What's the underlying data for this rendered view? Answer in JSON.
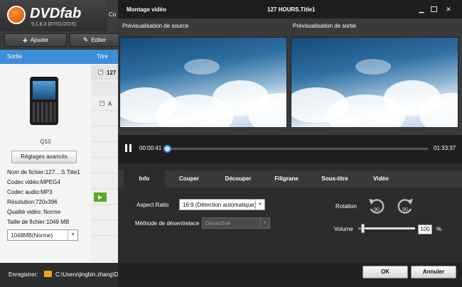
{
  "app": {
    "logo_text": "DVDfab",
    "version": "9.1.8.3 (07/01/2015)",
    "add_label": "Ajouter",
    "edit_label": "Editer",
    "topright_tab": "Co",
    "output_header": "Sortie",
    "title_header": "Titre",
    "title_row_1": "127",
    "title_row_2": "A",
    "device_name": "Q10",
    "advanced_settings": "Réglages avancés",
    "file_info": [
      "Nom de fichier:127....S.Title1",
      "Codec vidéo:MPEG4",
      "Codec audio:MP3",
      "Résolution:720x396",
      "Qualité vidéo: Norme",
      "Taille de fichier:1049 MB"
    ],
    "size_select": "1048MB(Norme)",
    "save_label": "Enregistrer:",
    "save_path": "C:\\Users\\jingbin.zhang\\D"
  },
  "dialog": {
    "title": "Montage vidéo",
    "file_title": "127  HOURS.Title1",
    "source_label": "Prévisualisation de source",
    "output_label": "Prévisualisation de sortie",
    "current_time": "00:00:41",
    "total_time": "01:33:37",
    "progress": 0.0073,
    "tabs": [
      "Info",
      "Couper",
      "Découper",
      "Filigrane",
      "Sous-titre",
      "Vidéo"
    ],
    "active_tab": "Info",
    "aspect_label": "Aspect Ratio",
    "aspect_value": "16:9 (Détection automatique)",
    "deinterlace_label": "Méthode de désentrelace",
    "deinterlace_value": "Désactivé",
    "rotation_label": "Rotation",
    "rotate_left_value": "90",
    "rotate_right_value": "90",
    "volume_label": "Volume",
    "volume_value": "100",
    "volume_unit": "%",
    "volume_level": 0.05,
    "ok_label": "OK",
    "cancel_label": "Annuler"
  },
  "colors": {
    "accent": "#3c8ed8",
    "dialog_bg": "#2c2c2c"
  }
}
